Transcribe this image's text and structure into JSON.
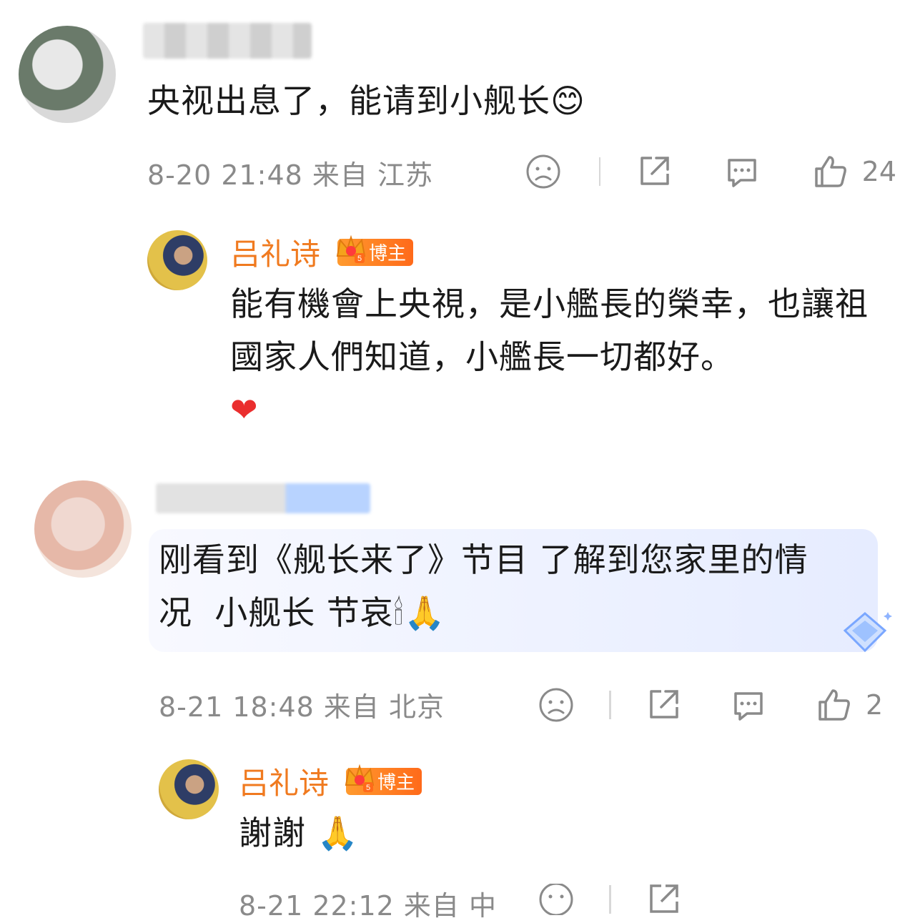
{
  "comments": [
    {
      "text": "央视出息了，能请到小舰长",
      "emoji": "😊",
      "meta": "8-20 21:48 来自 江苏",
      "likes": "24",
      "reply": {
        "author": "吕礼诗",
        "badge": "博主",
        "text": "能有機會上央視，是小艦長的榮幸，也讓祖國家人們知道，小艦長一切都好。",
        "emoji": "❤"
      }
    },
    {
      "text_line1": "刚看到《舰长来了》节目 了解到您家里的情",
      "text_line2": "况  小舰长 节哀",
      "emoji": "🕯🙏",
      "meta": "8-21 18:48 来自 北京",
      "likes": "2",
      "reply": {
        "author": "吕礼诗",
        "badge": "博主",
        "text": "謝謝",
        "emoji": "🙏",
        "meta": "8-21 22:12 来自 中"
      }
    }
  ],
  "icons": [
    "dislike-icon",
    "share-icon",
    "comment-icon",
    "like-icon"
  ],
  "colors": {
    "accent": "#f07a1f",
    "meta": "#8a8a8a",
    "text": "#1a1a1a"
  }
}
